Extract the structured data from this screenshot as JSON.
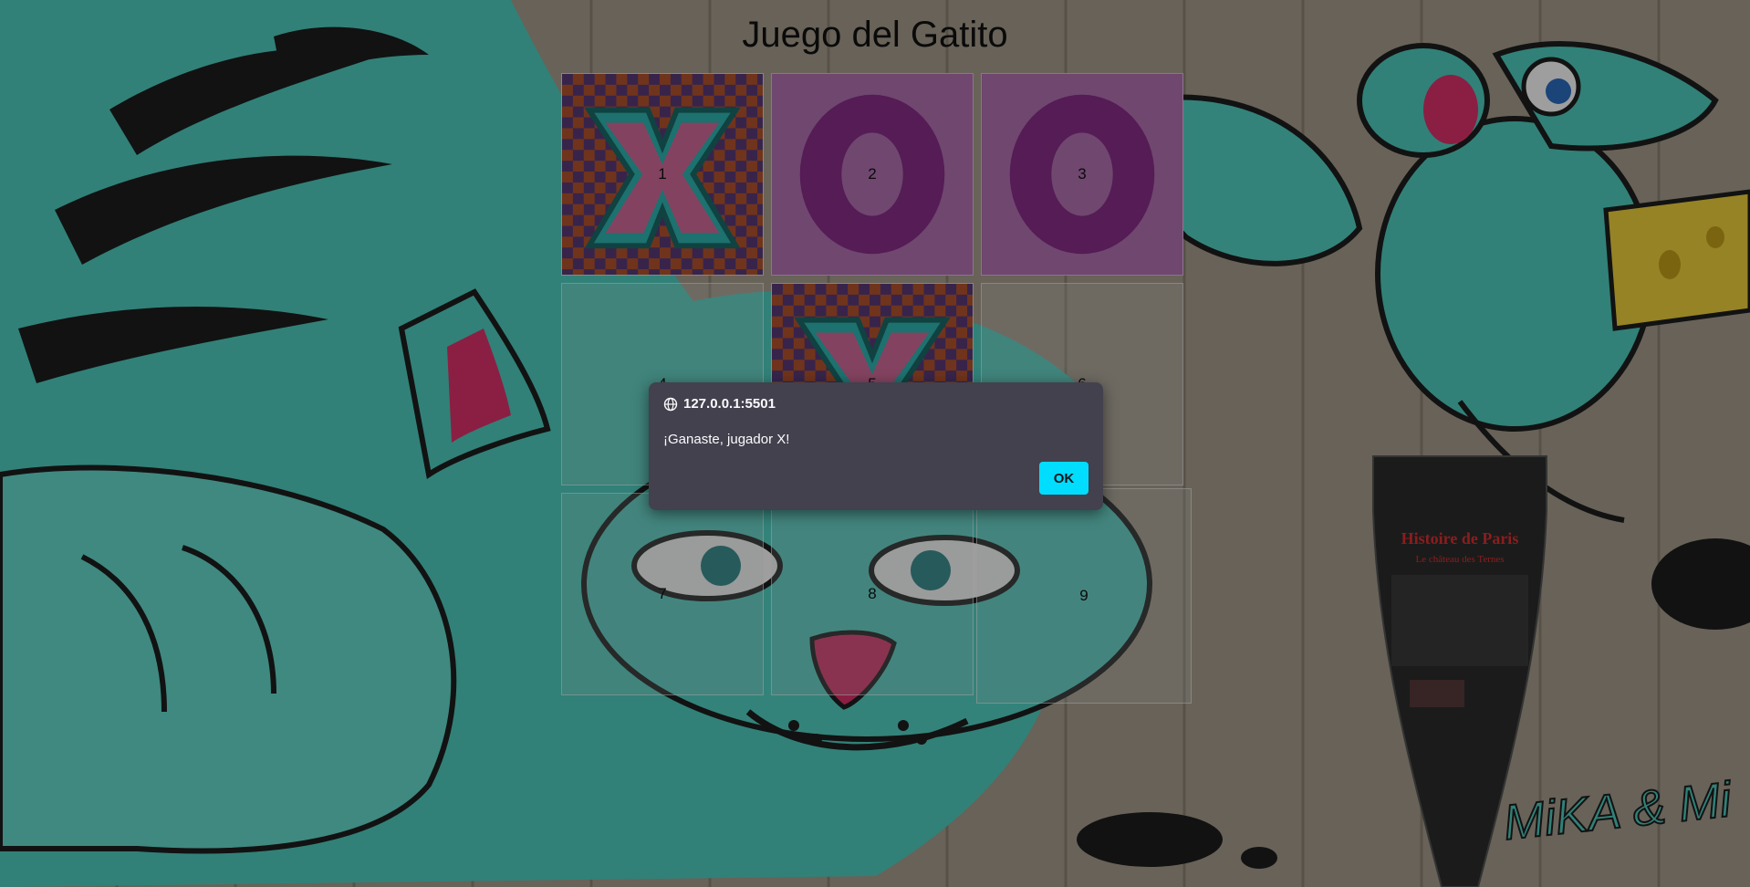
{
  "page": {
    "title": "Juego del Gatito"
  },
  "board": {
    "cells": [
      {
        "number": "1",
        "mark": "X"
      },
      {
        "number": "2",
        "mark": "O"
      },
      {
        "number": "3",
        "mark": "O"
      },
      {
        "number": "4",
        "mark": ""
      },
      {
        "number": "5",
        "mark": "X"
      },
      {
        "number": "6",
        "mark": ""
      },
      {
        "number": "7",
        "mark": ""
      },
      {
        "number": "8",
        "mark": ""
      },
      {
        "number": "9",
        "mark": ""
      }
    ]
  },
  "background": {
    "plaque_title": "Histoire de Paris",
    "plaque_subtitle": "Le château des Ternes",
    "signature": "MiKA & Mi"
  },
  "alert": {
    "origin": "127.0.0.1:5501",
    "message": "¡Ganaste, jugador X!",
    "ok_label": "OK"
  },
  "colors": {
    "ok_button": "#00ddff",
    "dialog_bg": "#42414d",
    "o_tile": "#b373b3",
    "o_ring": "#8a2e8a",
    "x_teal": "#2fb7b3",
    "x_pink": "#d36d9b"
  }
}
